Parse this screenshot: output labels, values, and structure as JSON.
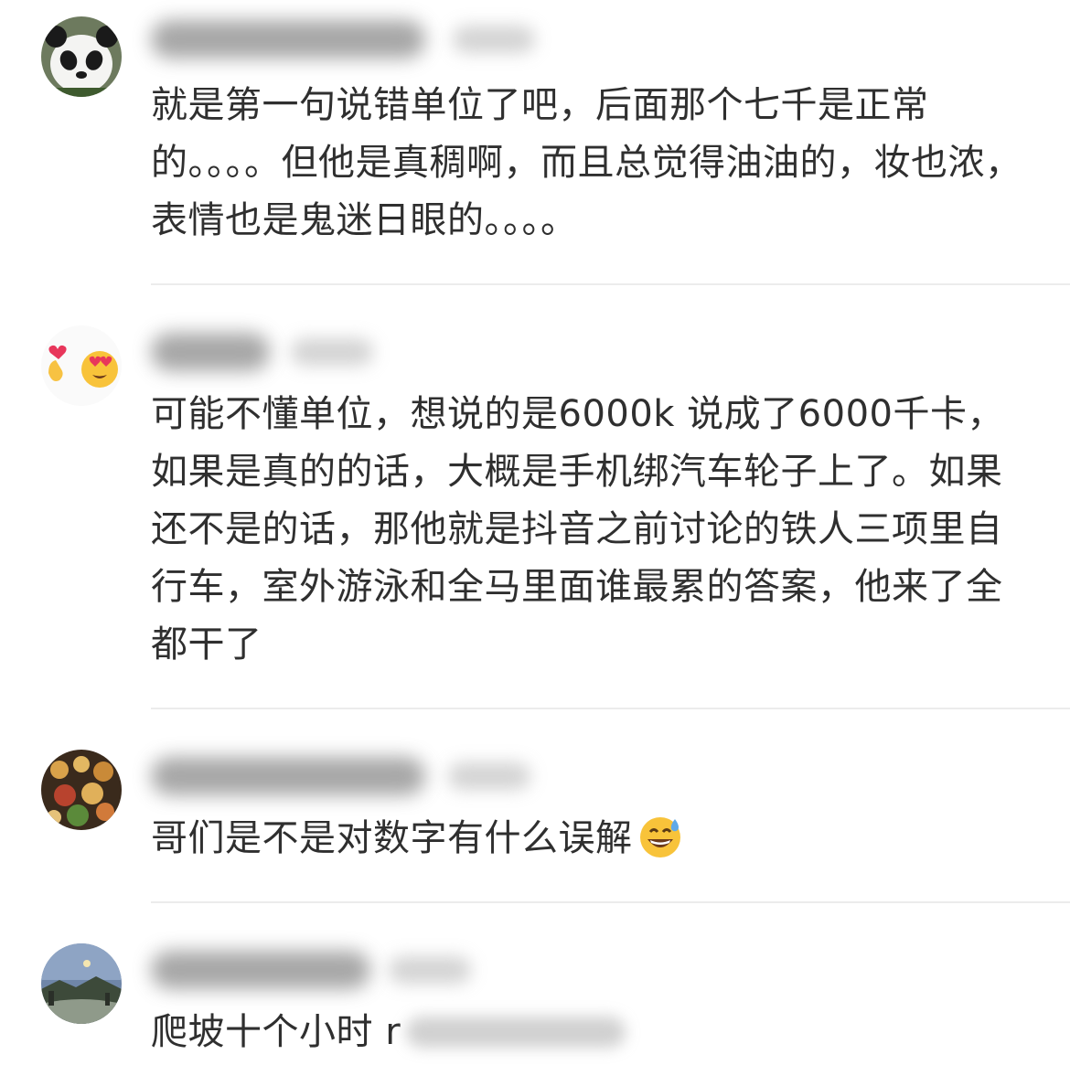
{
  "comments": [
    {
      "avatar_icon": "panda-avatar-icon",
      "text": "就是第一句说错单位了吧，后面那个七千是正常的。。。。但他是真稠啊，而且总觉得油油的，妆也浓，表情也是鬼迷日眼的。。。。"
    },
    {
      "avatar_icon": "emoji-heart-avatar-icon",
      "text": "可能不懂单位，想说的是6000k 说成了6000千卡，如果是真的的话，大概是手机绑汽车轮子上了。如果还不是的话，那他就是抖音之前讨论的铁人三项里自行车，室外游泳和全马里面谁最累的答案，他来了全都干了"
    },
    {
      "avatar_icon": "food-avatar-icon",
      "text": "哥们是不是对数字有什么误解",
      "trailing_emoji": "grinning-sweat-emoji-icon"
    },
    {
      "avatar_icon": "landscape-avatar-icon",
      "text": "爬坡十个小时 r"
    }
  ]
}
